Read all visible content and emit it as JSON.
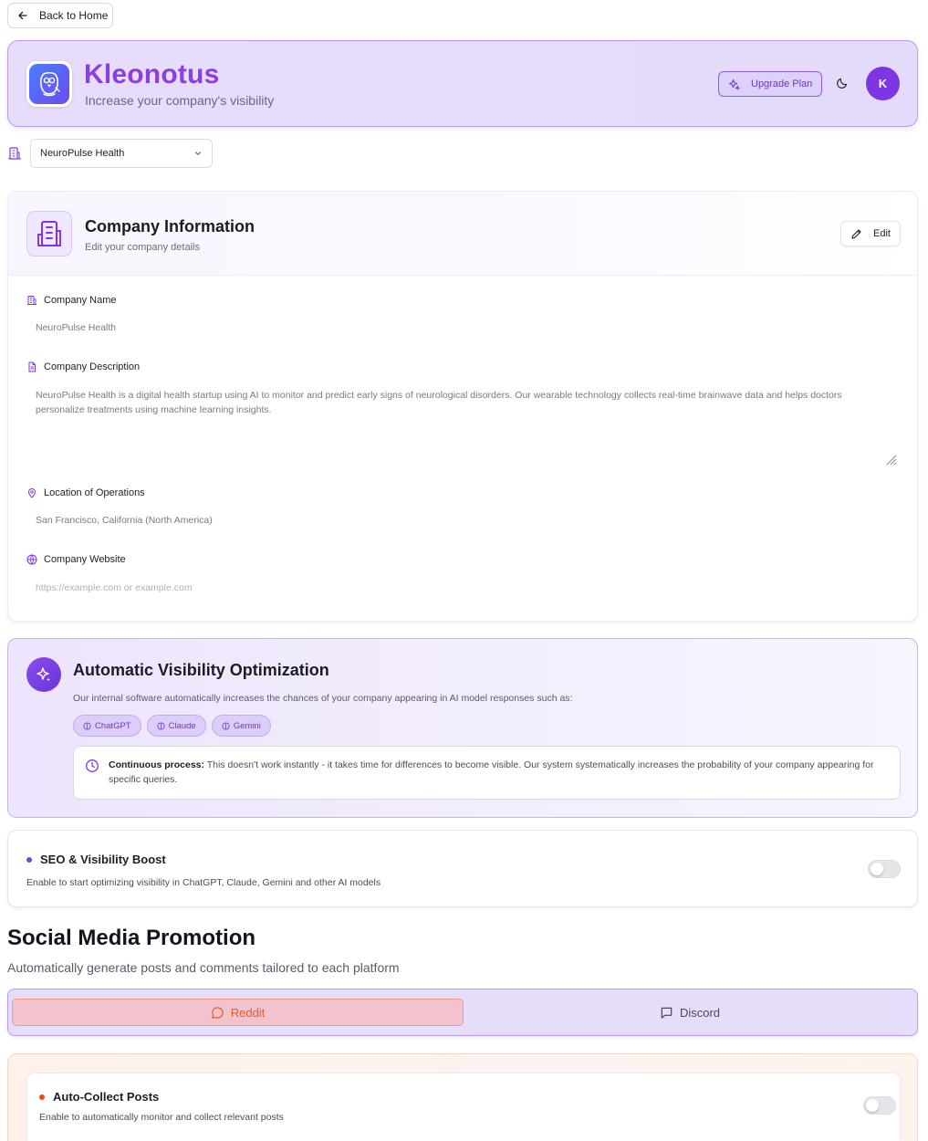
{
  "nav": {
    "back_label": "Back to Home"
  },
  "header": {
    "brand": "Kleonotus",
    "tagline": "Increase your company's visibility",
    "upgrade_label": "Upgrade Plan",
    "avatar_initial": "K"
  },
  "company_selector": {
    "selected": "NeuroPulse Health"
  },
  "company_info": {
    "title": "Company Information",
    "subtitle": "Edit your company details",
    "edit_label": "Edit",
    "fields": {
      "name_label": "Company Name",
      "name_value": "NeuroPulse Health",
      "description_label": "Company Description",
      "description_value": "NeuroPulse Health is a digital health startup using AI to monitor and predict early signs of neurological disorders. Our wearable technology collects real-time brainwave data and helps doctors personalize treatments using machine learning insights.",
      "location_label": "Location of Operations",
      "location_value": "San Francisco, California (North America)",
      "website_label": "Company Website",
      "website_placeholder": "https://example.com or example.com"
    }
  },
  "visibility": {
    "title": "Automatic Visibility Optimization",
    "description": "Our internal software automatically increases the chances of your company appearing in AI model responses such as:",
    "chips": [
      "ChatGPT",
      "Claude",
      "Gemini"
    ],
    "process_bold": "Continuous process:",
    "process_text": " This doesn't work instantly - it takes time for differences to become visible. Our system systematically increases the probability of your company appearing for specific queries."
  },
  "seo": {
    "title": "SEO & Visibility Boost",
    "subtitle": "Enable to start optimizing visibility in ChatGPT, Claude, Gemini and other AI models",
    "enabled": false
  },
  "social": {
    "title": "Social Media Promotion",
    "subtitle": "Automatically generate posts and comments tailored to each platform",
    "tabs": [
      {
        "label": "Reddit",
        "active": true
      },
      {
        "label": "Discord",
        "active": false
      }
    ],
    "auto_collect": {
      "title": "Auto-Collect Posts",
      "subtitle": "Enable to automatically monitor and collect relevant posts",
      "enabled": false
    }
  },
  "colors": {
    "brand": "#8b3fe3",
    "accent": "#7e35e4",
    "reddit": "#ee5b1f",
    "seo_dot": "#7b3fe0",
    "reddit_dot": "#ee4a12"
  }
}
